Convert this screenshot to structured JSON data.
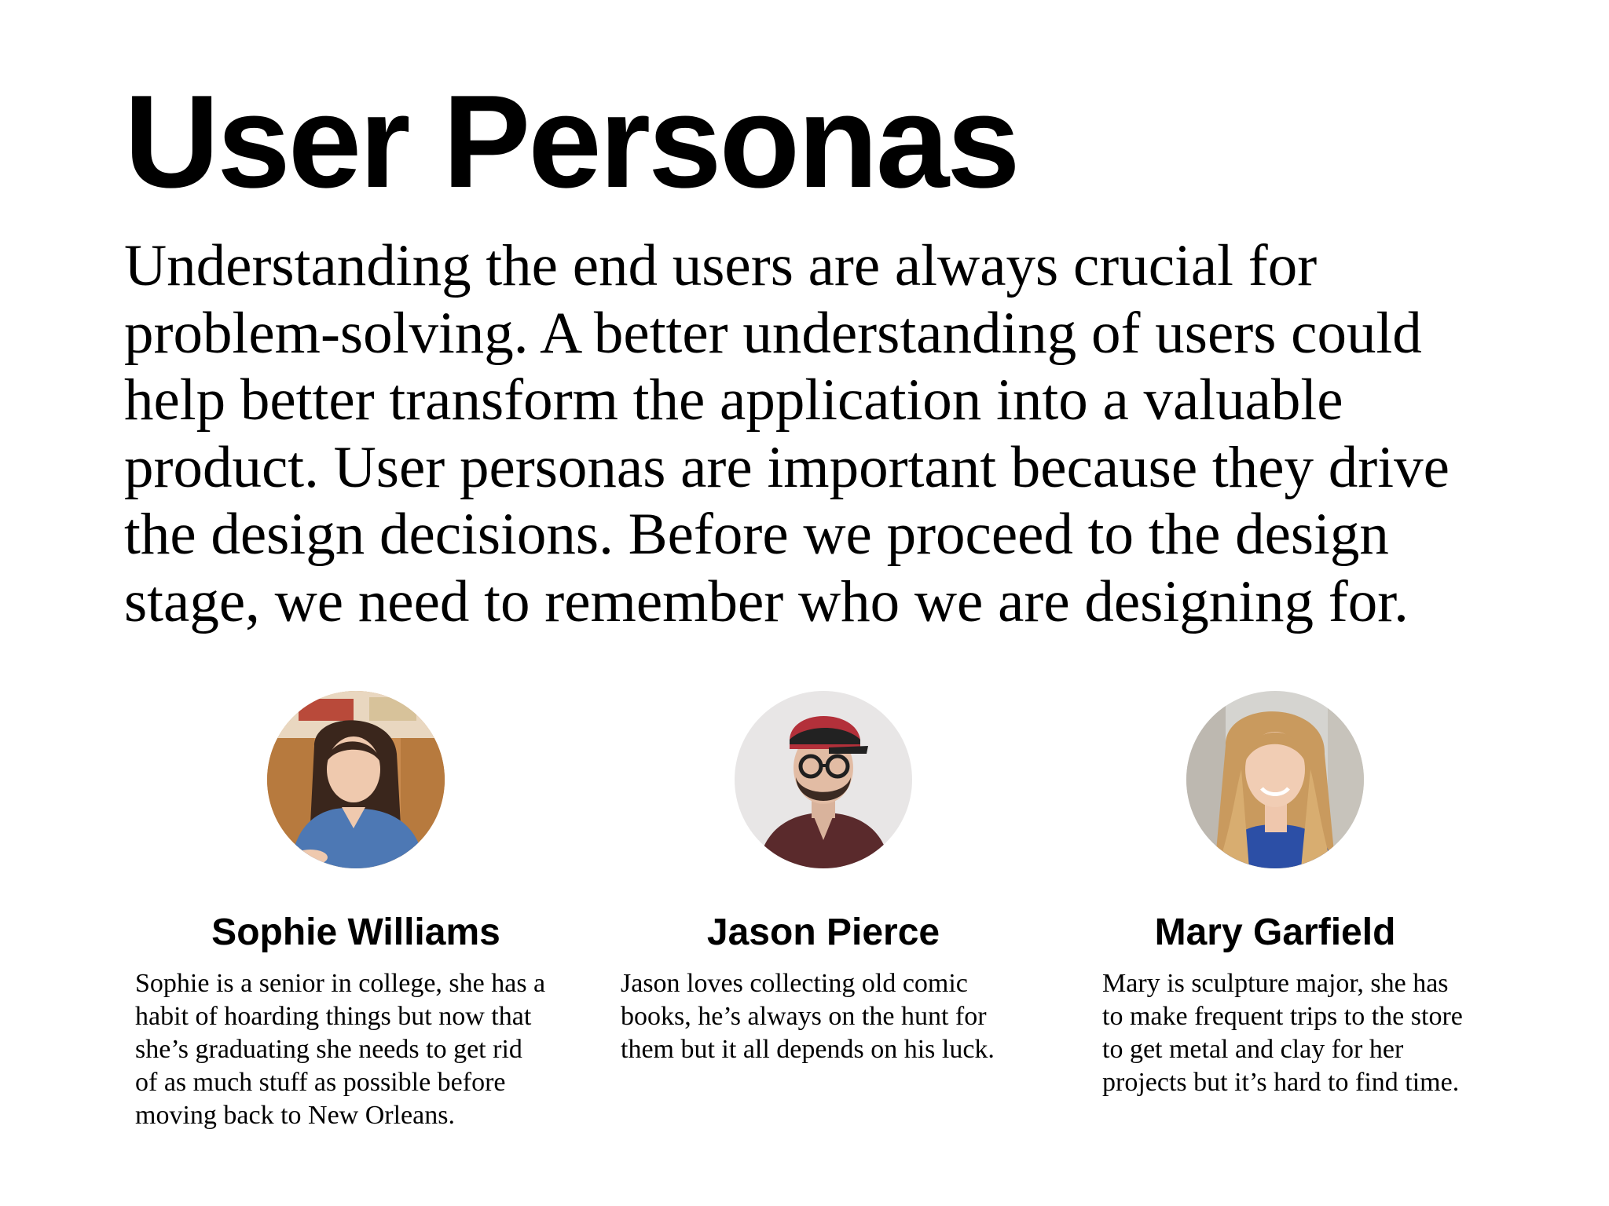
{
  "title": "User Personas",
  "intro_lines": [
    "Understanding the end users are always crucial for",
    "problem-solving. A better understanding of users could",
    "help better transform the application into a valuable",
    "product. User personas are important because they drive",
    "the design decisions. Before we proceed to the design",
    "stage, we need to remember who we are designing for."
  ],
  "personas": [
    {
      "name": "Sophie Williams",
      "bio_lines": [
        "Sophie is a senior in college, she has a",
        "habit of hoarding things but now that",
        "she’s graduating she needs to get rid",
        "of as much stuff as possible before",
        "moving back to New Orleans."
      ]
    },
    {
      "name": "Jason Pierce",
      "bio_lines": [
        "Jason loves collecting old comic",
        "books, he’s always on the hunt for",
        "them but it all depends on his luck."
      ]
    },
    {
      "name": "Mary Garfield",
      "bio_lines": [
        "Mary is sculpture major, she has",
        "to make frequent trips to the store",
        "to get metal and clay for her",
        "projects but it’s hard to find time."
      ]
    }
  ]
}
